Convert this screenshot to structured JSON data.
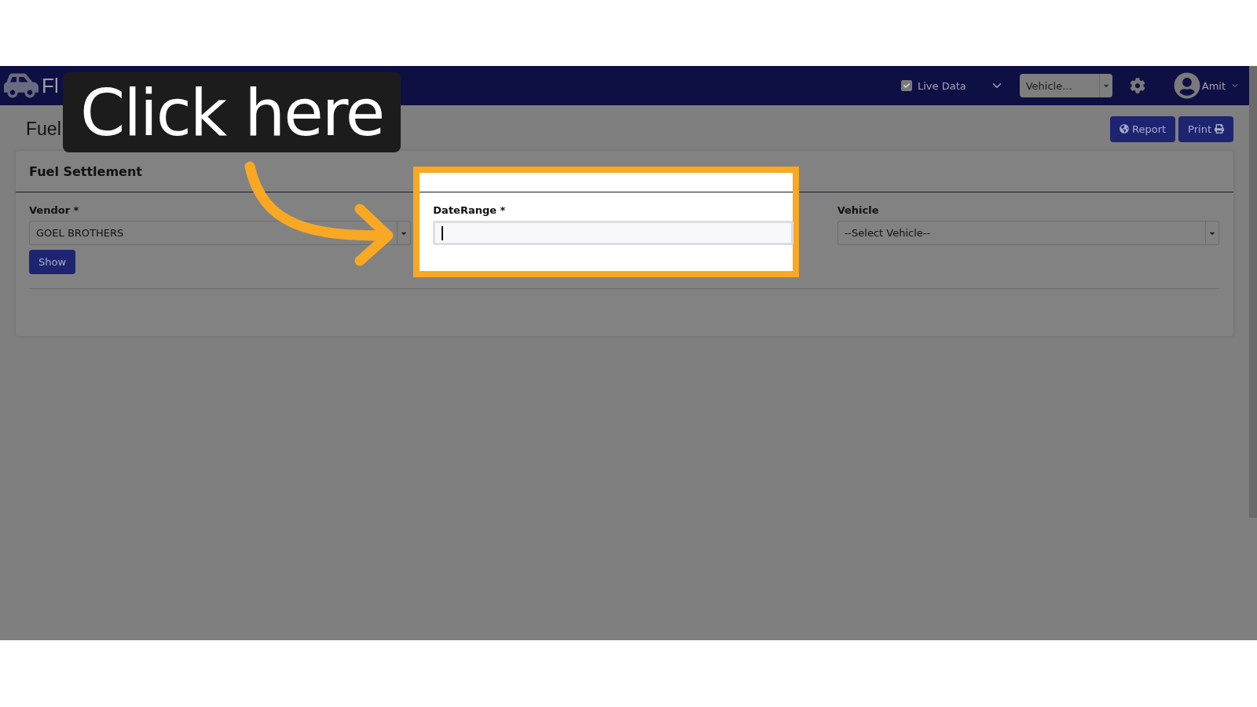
{
  "overlay": {
    "caption": "Click here"
  },
  "navbar": {
    "brand": "Fl",
    "live_data": {
      "label": "Live Data",
      "checked": true
    },
    "vehicle_select": {
      "placeholder": "Vehicle..."
    },
    "user": {
      "name": "Amit"
    }
  },
  "page": {
    "title": "Fuel",
    "buttons": [
      {
        "label": "Report",
        "kind": "report"
      },
      {
        "label": "Print",
        "kind": "print"
      }
    ]
  },
  "card": {
    "title": "Fuel Settlement",
    "fields": [
      {
        "label": "Vendor *",
        "kind": "select",
        "value": "GOEL BROTHERS",
        "highlighted": false,
        "focused": false
      },
      {
        "label": "DateRange *",
        "kind": "date",
        "highlighted": true,
        "focused": true
      },
      {
        "label": "Vehicle",
        "kind": "select",
        "placeholder": "--Select Vehicle--",
        "highlighted": false,
        "focused": false
      }
    ],
    "show_button": "Show"
  }
}
